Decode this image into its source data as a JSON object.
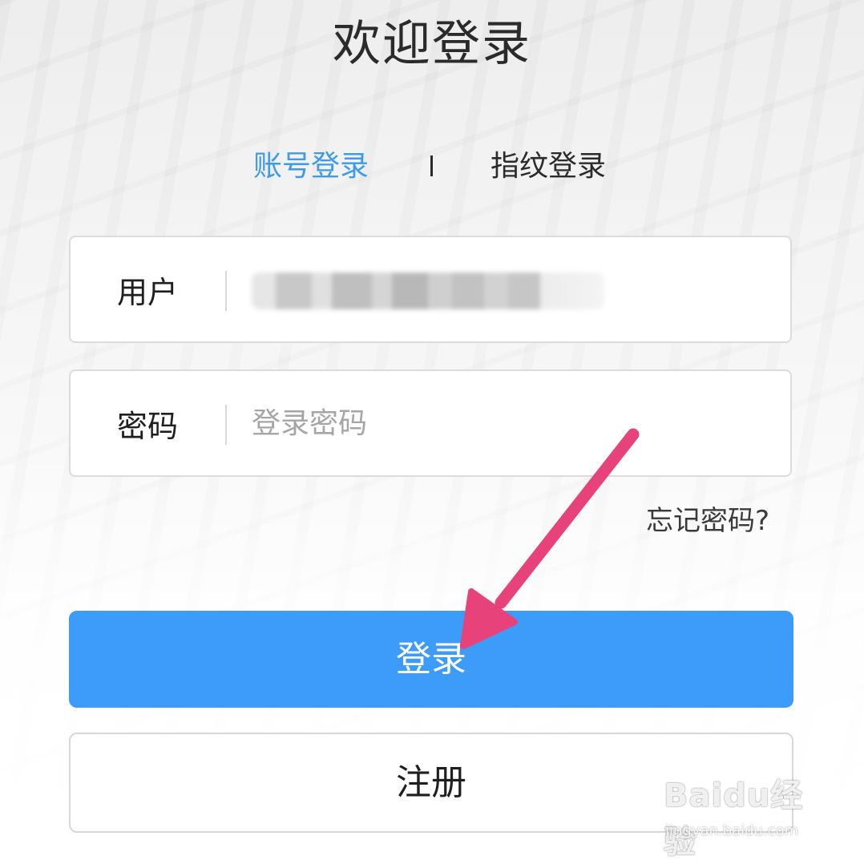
{
  "page": {
    "title": "欢迎登录"
  },
  "tabs": [
    {
      "label": "账号登录",
      "active": true
    },
    {
      "label": "指纹登录",
      "active": false
    }
  ],
  "username_field": {
    "label": "用户",
    "value_blurred": true
  },
  "password_field": {
    "label": "密码",
    "placeholder": "登录密码"
  },
  "forgot_password": "忘记密码?",
  "login_button": "登录",
  "register_button": "注册",
  "watermark": {
    "logo": "Baidu经验",
    "url": "jingyan.baidu.com"
  },
  "colors": {
    "accent": "#3d9bf9",
    "active_tab": "#3d9be9",
    "arrow": "#e8427a"
  }
}
